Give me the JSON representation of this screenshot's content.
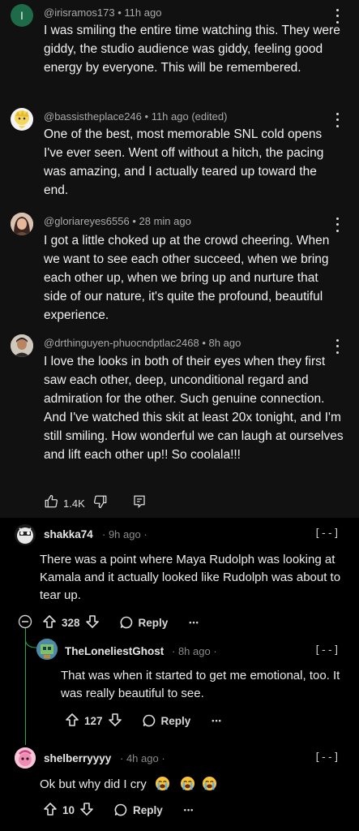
{
  "youtube": {
    "comments": [
      {
        "author": "@irisramos173",
        "time": "11h ago",
        "text": "I was smiling the entire time watching this. They were giddy, the studio audience was giddy, feeling good energy by everyone. This will be remembered.",
        "avatar_letter": "I",
        "avatar_color": "#1e6b4a"
      },
      {
        "author": "@bassistheplace246",
        "time": "11h ago (edited)",
        "text": "One of the best, most memorable SNL cold opens I've ever seen. Went off without a hitch, the pacing was amazing, and I actually teared up toward the end."
      },
      {
        "author": "@gloriareyes6556",
        "time": "28 min ago",
        "text": "I got a little choked up at the crowd cheering. When we want to see each other succeed, when we bring each other up, when we bring up and nurture that side of our nature, it's quite the profound, beautiful experience."
      },
      {
        "author": "@drthinguyen-phuocndptlac2468",
        "time": "8h ago",
        "text": "I love the looks in both of their eyes when they first saw each other, deep, unconditional regard and admiration for the other. Such genuine connection. And I've watched this skit at least 20x tonight, and I'm still smiling. How wonderful we can laugh at ourselves and lift each other up!! So coolala!!!"
      }
    ],
    "actions": {
      "like_count": "1.4K"
    }
  },
  "reddit": {
    "comments": [
      {
        "user": "shakka74",
        "time": "· 9h ago ·",
        "collapse": "[--]",
        "text": "There was a point where Maya Rudolph was looking at Kamala and it actually looked like Rudolph was about to tear up.",
        "votes": "328",
        "reply_label": "Reply",
        "more": "•••"
      },
      {
        "user": "TheLoneliestGhost",
        "time": "· 8h ago ·",
        "collapse": "[--]",
        "text": "That was when it started to get me emotional, too. It was really beautiful to see.",
        "votes": "127",
        "reply_label": "Reply",
        "more": "•••"
      },
      {
        "user": "shelberryyyy",
        "time": "· 4h ago ·",
        "collapse": "[--]",
        "text": "Ok but why did I cry",
        "votes": "10",
        "reply_label": "Reply",
        "more": "•••"
      }
    ],
    "colors": {
      "thread_line": "#1faa4a"
    }
  }
}
